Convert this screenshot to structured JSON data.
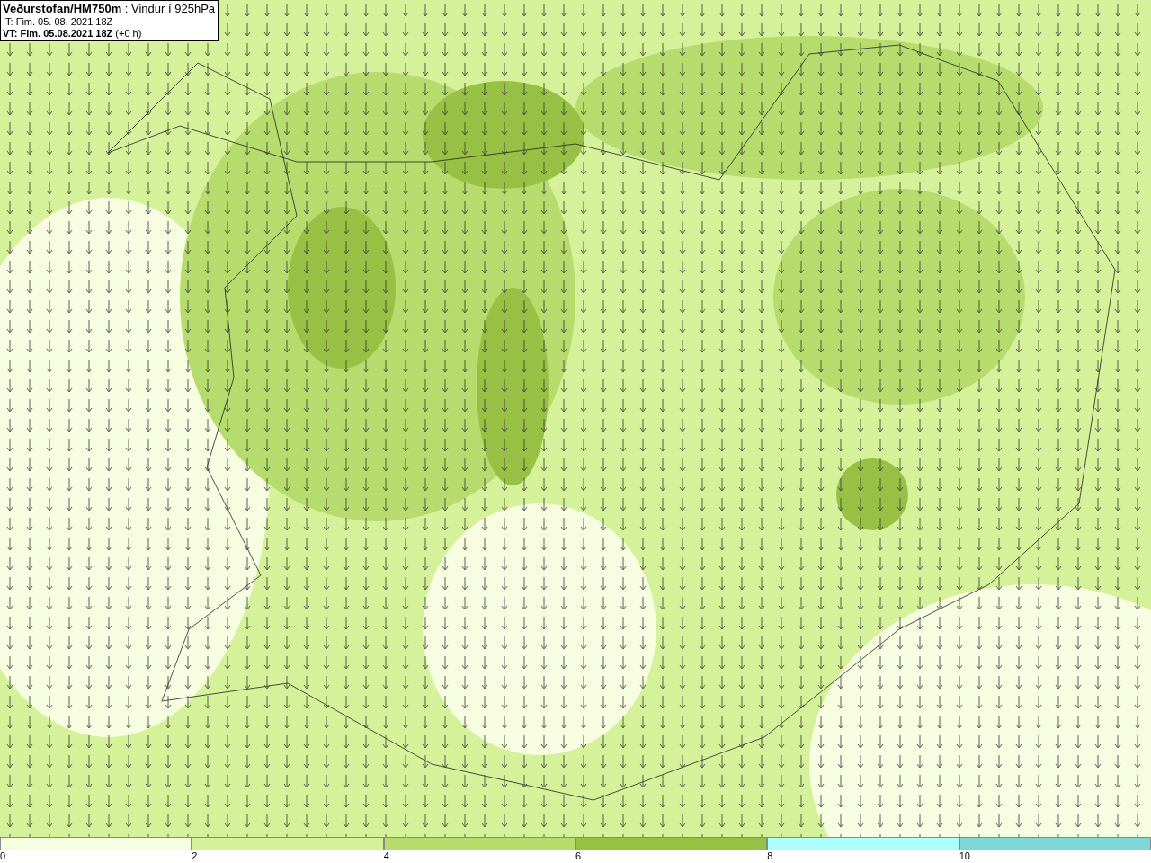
{
  "info_box": {
    "title": "**Veðurstofan/HM750m** : Vindur í 925hPa",
    "issue_time": "IT: Fim. 05. 08. 2021 18Z",
    "valid_time": "**VT: Fim. 05.08.2021 18Z** (+0 h)"
  },
  "legend": [
    {
      "label": "0",
      "color": "#f7fde0"
    },
    {
      "label": "2",
      "color": "#d5f29a"
    },
    {
      "label": "4",
      "color": "#b5dc6c"
    },
    {
      "label": "6",
      "color": "#97c144"
    },
    {
      "label": "8",
      "color": "#adfefe"
    },
    {
      "label": "10",
      "color": "#7fd8d8"
    }
  ]
}
